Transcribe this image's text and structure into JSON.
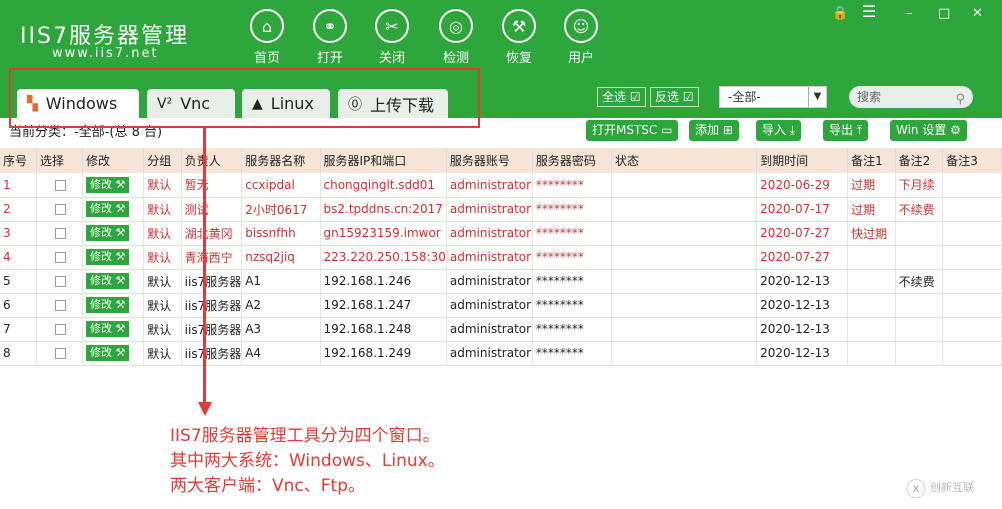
{
  "app": {
    "title": "IIS7服务器管理",
    "url": "www.iis7.net"
  },
  "nav": [
    {
      "label": "首页",
      "icon": "home-icon"
    },
    {
      "label": "打开",
      "icon": "link-icon"
    },
    {
      "label": "关闭",
      "icon": "unlink-icon"
    },
    {
      "label": "检测",
      "icon": "radar-icon"
    },
    {
      "label": "恢复",
      "icon": "wrench-icon"
    },
    {
      "label": "用户",
      "icon": "user-icon"
    }
  ],
  "tabs": [
    {
      "label": "Windows",
      "icon": "windows-icon"
    },
    {
      "label": "Vnc",
      "icon": "vnc-icon"
    },
    {
      "label": "Linux",
      "icon": "linux-icon"
    },
    {
      "label": "上传下载",
      "icon": "upload-icon"
    }
  ],
  "toolbar": {
    "select_all": "全选",
    "invert": "反选",
    "filter_value": "-全部-",
    "search_placeholder": "搜索"
  },
  "crumb": "当前分类：-全部-(总 8 台)",
  "actions": {
    "mstsc": "打开MSTSC",
    "add": "添加",
    "import": "导入",
    "export": "导出",
    "settings": "Win 设置"
  },
  "columns": [
    "序号",
    "选择",
    "修改",
    "分组",
    "负责人",
    "服务器名称",
    "服务器IP和端口",
    "服务器账号",
    "服务器密码",
    "状态",
    "到期时间",
    "备注1",
    "备注2",
    "备注3"
  ],
  "edit_label": "修改",
  "rows": [
    {
      "no": "1",
      "group": "默认",
      "owner": "暂无",
      "name": "ccxipdal",
      "ip": "chongqinglt.sdd01",
      "account": "administrator",
      "pwd": "********",
      "expire": "2020-06-29",
      "n1": "过期",
      "n2": "下月续",
      "n3": "",
      "red": true
    },
    {
      "no": "2",
      "group": "默认",
      "owner": "测试",
      "name": "2小时0617",
      "ip": "bs2.tpddns.cn:2017",
      "account": "administrator",
      "pwd": "********",
      "expire": "2020-07-17",
      "n1": "过期",
      "n2": "不续费",
      "n3": "",
      "red": true
    },
    {
      "no": "3",
      "group": "默认",
      "owner": "湖北黄冈",
      "name": "bissnfhh",
      "ip": "gn15923159.imwor",
      "account": "administrator",
      "pwd": "********",
      "expire": "2020-07-27",
      "n1": "快过期",
      "n2": "",
      "n3": "",
      "red": true
    },
    {
      "no": "4",
      "group": "默认",
      "owner": "青海西宁",
      "name": "nzsq2jiq",
      "ip": "223.220.250.158:30",
      "account": "administrator",
      "pwd": "********",
      "expire": "2020-07-27",
      "n1": "",
      "n2": "",
      "n3": "",
      "red": true
    },
    {
      "no": "5",
      "group": "默认",
      "owner": "iis7服务器",
      "name": "A1",
      "ip": "192.168.1.246",
      "account": "administrator",
      "pwd": "********",
      "expire": "2020-12-13",
      "n1": "",
      "n2": "不续费",
      "n3": "",
      "red": false
    },
    {
      "no": "6",
      "group": "默认",
      "owner": "iis7服务器",
      "name": "A2",
      "ip": "192.168.1.247",
      "account": "administrator",
      "pwd": "********",
      "expire": "2020-12-13",
      "n1": "",
      "n2": "",
      "n3": "",
      "red": false
    },
    {
      "no": "7",
      "group": "默认",
      "owner": "iis7服务器",
      "name": "A3",
      "ip": "192.168.1.248",
      "account": "administrator",
      "pwd": "********",
      "expire": "2020-12-13",
      "n1": "",
      "n2": "",
      "n3": "",
      "red": false
    },
    {
      "no": "8",
      "group": "默认",
      "owner": "iis7服务器",
      "name": "A4",
      "ip": "192.168.1.249",
      "account": "administrator",
      "pwd": "********",
      "expire": "2020-12-13",
      "n1": "",
      "n2": "",
      "n3": "",
      "red": false
    }
  ],
  "annotation": [
    "IIS7服务器管理工具分为四个窗口。",
    "其中两大系统：Windows、Linux。",
    "两大客户端：Vnc、Ftp。"
  ],
  "watermark": "创新互联"
}
